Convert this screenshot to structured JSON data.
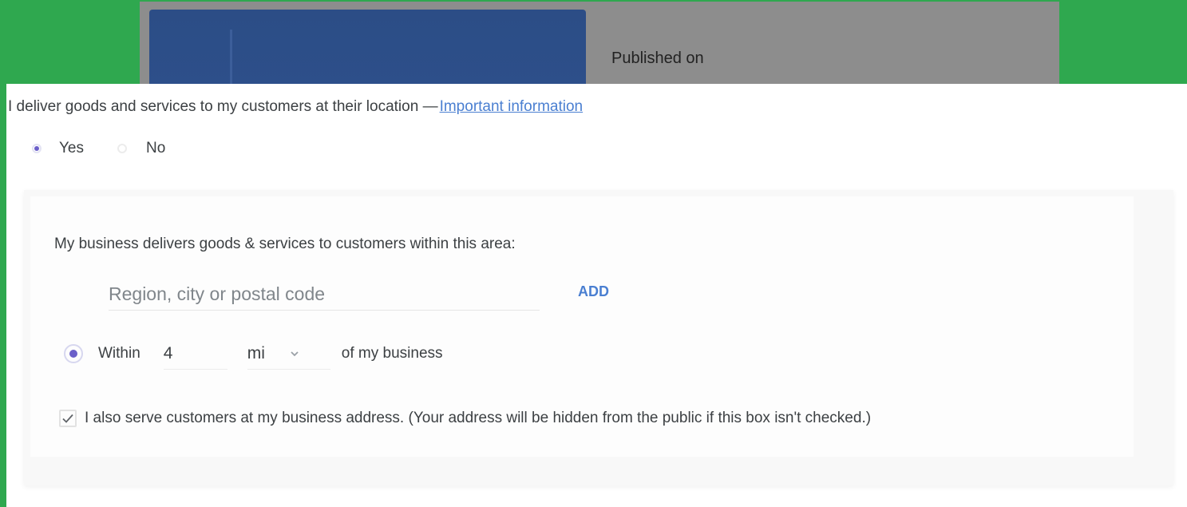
{
  "background": {
    "published_label": "Published on"
  },
  "question": {
    "text": "I deliver goods and services to my customers at their location —",
    "link_text": "Important information"
  },
  "delivery_options": [
    {
      "label": "Yes",
      "selected": true
    },
    {
      "label": "No",
      "selected": false
    }
  ],
  "service_area": {
    "label": "My business delivers goods & services to customers within this area:",
    "region_input": {
      "value": "",
      "placeholder": "Region, city or postal code"
    },
    "add_label": "ADD",
    "radius": {
      "selected": true,
      "within_label": "Within",
      "distance_value": "4",
      "unit": "mi",
      "suffix": "of my business"
    },
    "serve_at_address": {
      "checked": true,
      "label": "I also serve customers at my business address. (Your address will be hidden from the public if this box isn't checked.)"
    }
  },
  "colors": {
    "page_background": "#2fa84f",
    "accent_purple": "#6b5fc9",
    "link_blue": "#4a7fd1"
  }
}
